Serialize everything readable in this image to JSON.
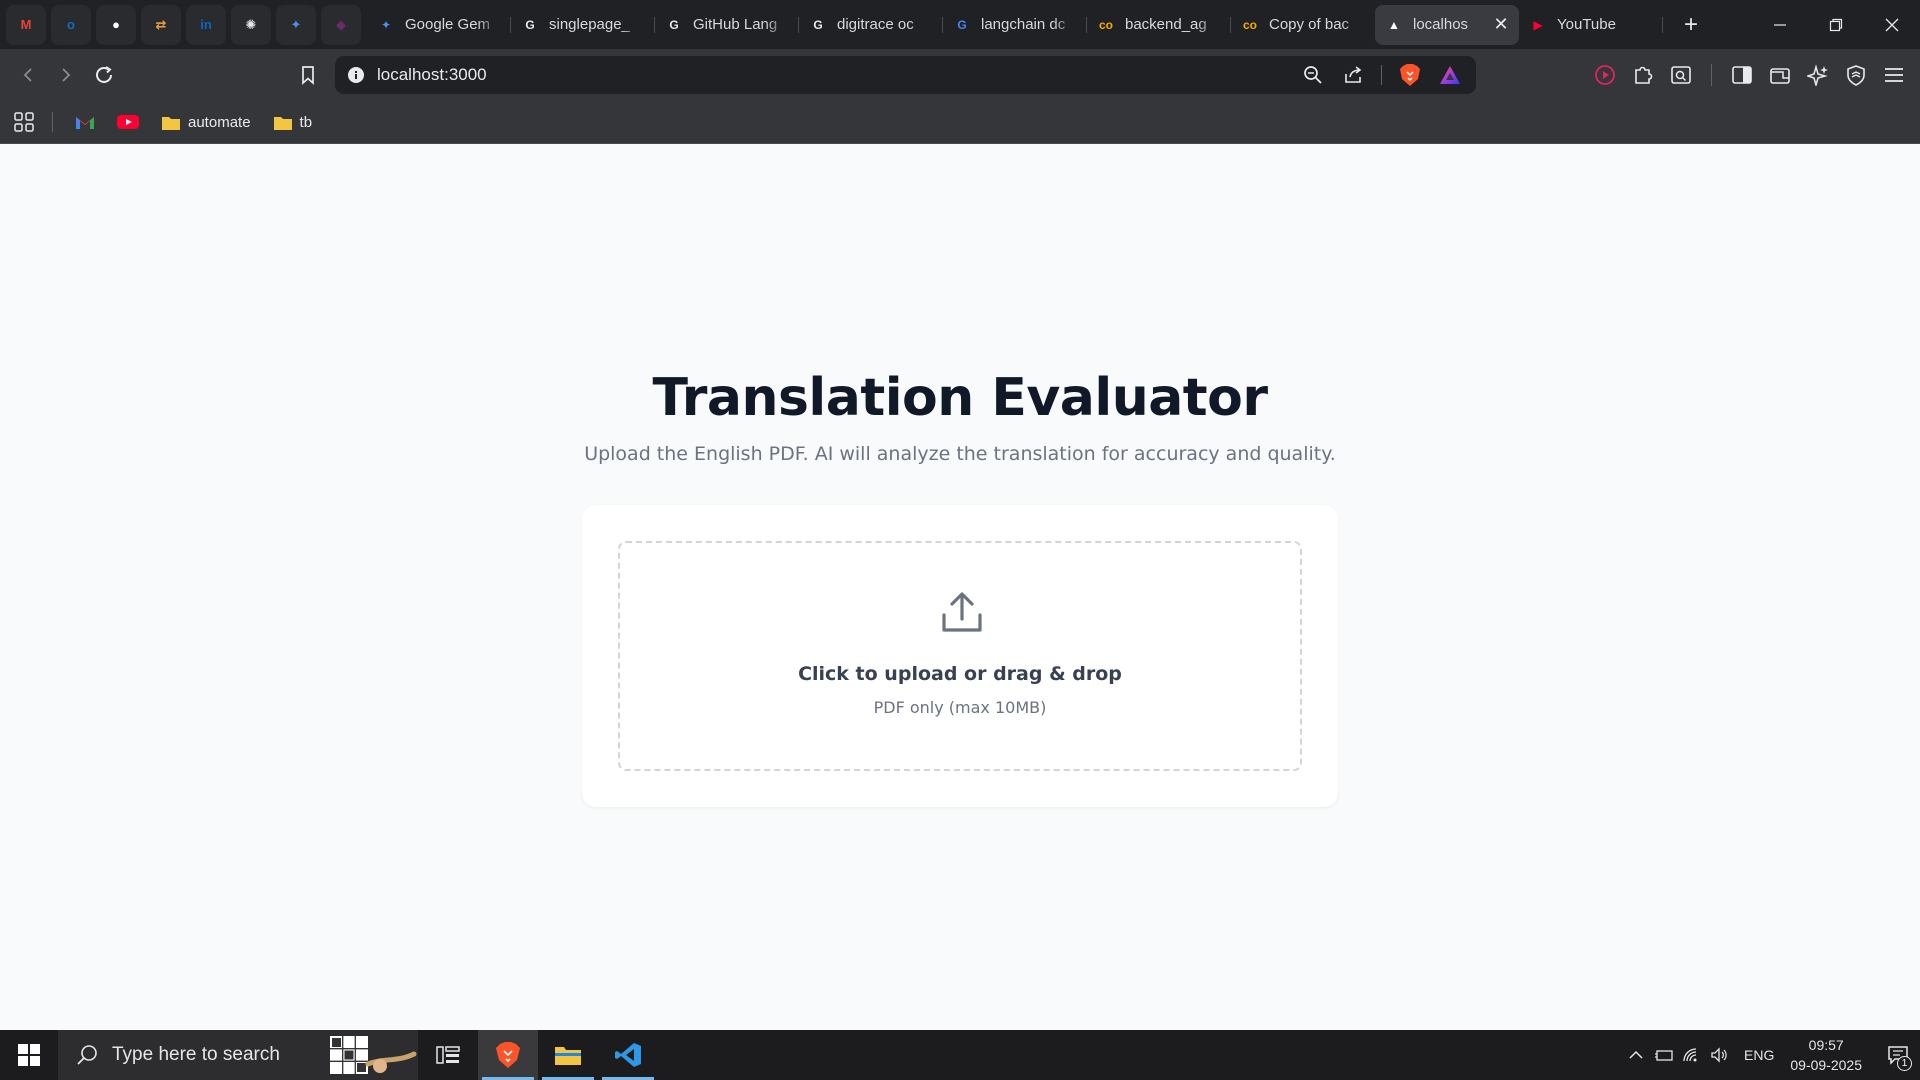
{
  "browser": {
    "pinned_tabs": [
      {
        "icon": "gmail-icon",
        "glyph": "M",
        "color": "#ea4335"
      },
      {
        "icon": "outlook-icon",
        "glyph": "o",
        "color": "#0f6cbd"
      },
      {
        "icon": "github-icon",
        "glyph": "●",
        "color": "#ffffff"
      },
      {
        "icon": "swap-icon",
        "glyph": "⇄",
        "color": "#f2a33a"
      },
      {
        "icon": "linkedin-icon",
        "glyph": "in",
        "color": "#0a66c2"
      },
      {
        "icon": "openai-icon",
        "glyph": "✺",
        "color": "#e8e8ea"
      },
      {
        "icon": "gemini-icon",
        "glyph": "✦",
        "color": "#4c8df6"
      },
      {
        "icon": "app-icon",
        "glyph": "◆",
        "color": "#6b2a6b"
      }
    ],
    "tabs": [
      {
        "title": "Google Gem",
        "icon": "gemini-icon",
        "glyph": "✦",
        "color": "#4c8df6"
      },
      {
        "title": "singlepage_",
        "icon": "chatgpt-icon",
        "glyph": "G",
        "color": "#e8e8ea"
      },
      {
        "title": "GitHub Lang",
        "icon": "chatgpt-icon",
        "glyph": "G",
        "color": "#e8e8ea"
      },
      {
        "title": "digitrace oc",
        "icon": "chatgpt-icon",
        "glyph": "G",
        "color": "#e8e8ea"
      },
      {
        "title": "langchain dc",
        "icon": "google-icon",
        "glyph": "G",
        "color": "#4285f4"
      },
      {
        "title": "backend_ag",
        "icon": "colab-icon",
        "glyph": "co",
        "color": "#f9ab00"
      },
      {
        "title": "Copy of bac",
        "icon": "colab-icon",
        "glyph": "co",
        "color": "#f9ab00"
      },
      {
        "title": "localhos",
        "icon": "vercel-icon",
        "glyph": "▲",
        "color": "#ffffff",
        "active": true
      },
      {
        "title": "YouTube",
        "icon": "youtube-icon",
        "glyph": "▶",
        "color": "#ff0033"
      }
    ],
    "url": "localhost:3000",
    "bookmarks": [
      {
        "label": "automate"
      },
      {
        "label": "tb"
      }
    ]
  },
  "page": {
    "title": "Translation Evaluator",
    "subtitle": "Upload the English PDF. AI will analyze the translation for accuracy and quality.",
    "dropzone": {
      "main_text": "Click to upload or drag & drop",
      "sub_text": "PDF only (max 10MB)"
    }
  },
  "taskbar": {
    "search_placeholder": "Type here to search",
    "language": "ENG",
    "time": "09:57",
    "date": "09-09-2025",
    "notification_count": "1"
  },
  "colors": {
    "page_bg": "#f9fafb",
    "title": "#111827",
    "muted": "#6b7280",
    "accent_vscode": "#2f98e6",
    "brave": "#fb542b"
  }
}
